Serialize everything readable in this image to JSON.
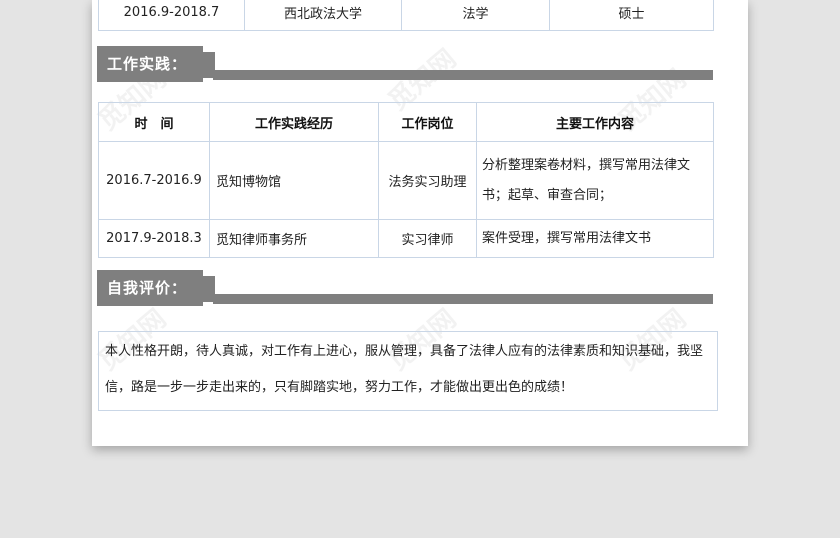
{
  "education_row": {
    "period": "2016.9-2018.7",
    "school": "西北政法大学",
    "major": "法学",
    "degree": "硕士"
  },
  "work_section": {
    "title": "工作实践：",
    "headers": [
      "时　间",
      "工作实践经历",
      "工作岗位",
      "主要工作内容"
    ],
    "rows": [
      {
        "period": "2016.7-2016.9",
        "place": "觅知博物馆",
        "position": "法务实习助理",
        "content": "分析整理案卷材料，撰写常用法律文书；起草、审查合同；"
      },
      {
        "period": "2017.9-2018.3",
        "place": "觅知律师事务所",
        "position": "实习律师",
        "content": "案件受理，撰写常用法律文书"
      }
    ]
  },
  "self_section": {
    "title": "自我评价：",
    "text": "本人性格开朗，待人真诚，对工作有上进心，服从管理，具备了法律人应有的法律素质和知识基础，我坚信，路是一步一步走出来的，只有脚踏实地，努力工作，才能做出更出色的成绩！"
  },
  "watermark": "觅知网"
}
